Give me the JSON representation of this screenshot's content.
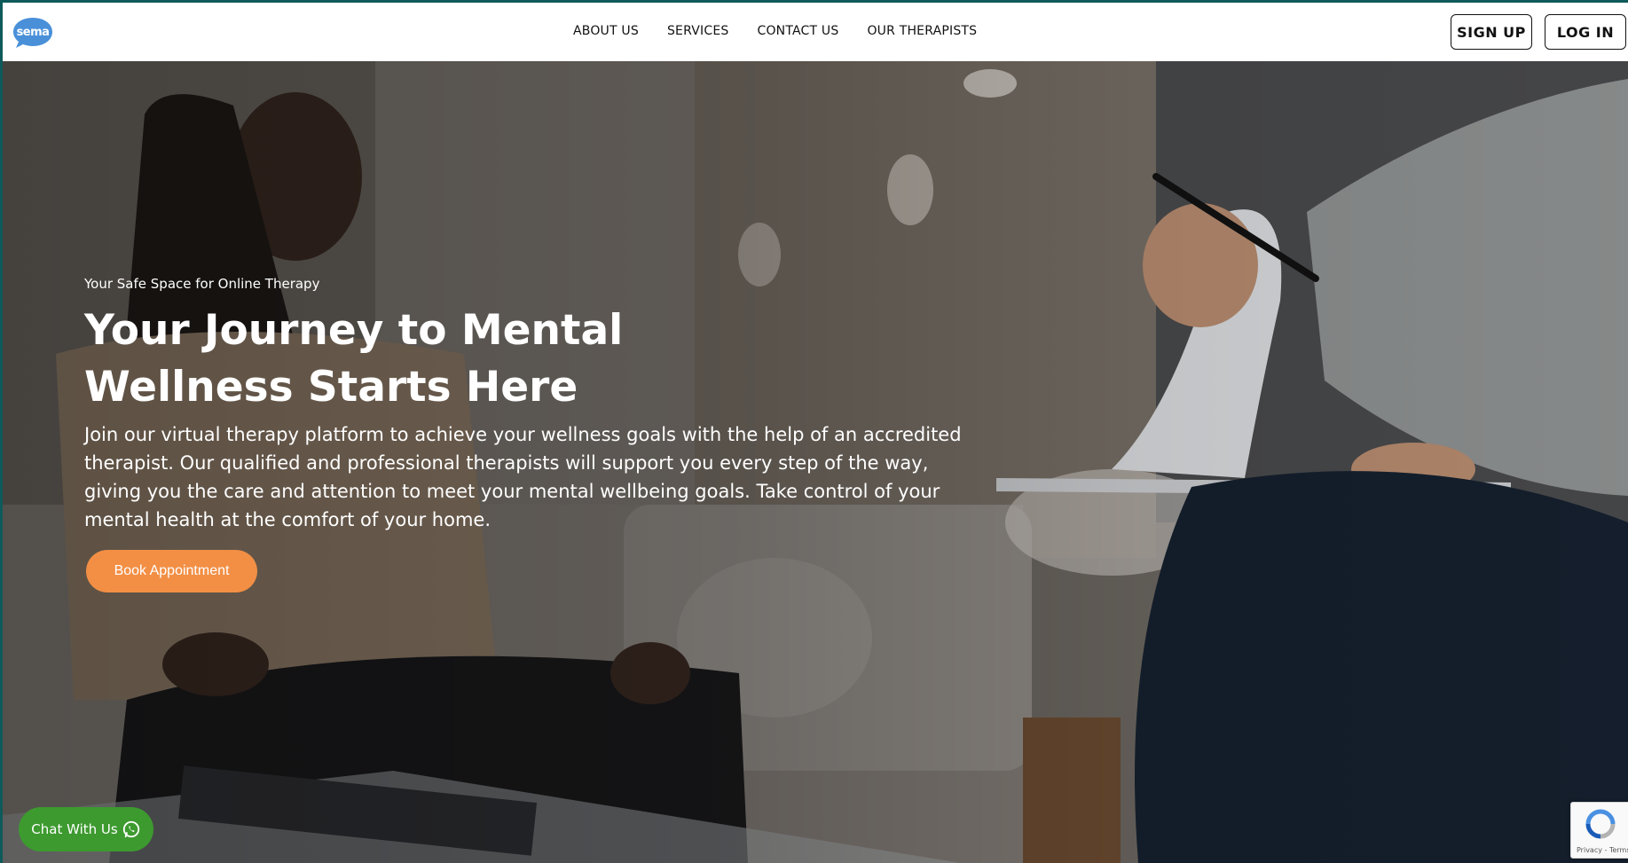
{
  "brand": {
    "logo_text": "sema",
    "logo_color": "#4a90d9"
  },
  "nav": {
    "items": [
      {
        "label": "ABOUT US"
      },
      {
        "label": "SERVICES"
      },
      {
        "label": "CONTACT US"
      },
      {
        "label": "OUR THERAPISTS"
      }
    ]
  },
  "auth": {
    "signup_label": "SIGN UP",
    "login_label": "LOG IN"
  },
  "hero": {
    "eyebrow": "Your Safe Space for Online Therapy",
    "headline": "Your Journey to Mental Wellness Starts Here",
    "intro": "Join our virtual therapy platform to achieve your wellness goals with the help of an accredited therapist. Our qualified and professional therapists will support you every step of the way, giving you the care and attention to meet your mental wellbeing goals. Take control of your mental health at the comfort of your home.",
    "cta_label": "Book Appointment",
    "cta_color": "#f28f45"
  },
  "chat": {
    "label": "Chat With Us",
    "icon": "whatsapp-icon",
    "color": "#3d9a2f"
  },
  "recaptcha": {
    "footer_text": "Privacy - Terms"
  }
}
